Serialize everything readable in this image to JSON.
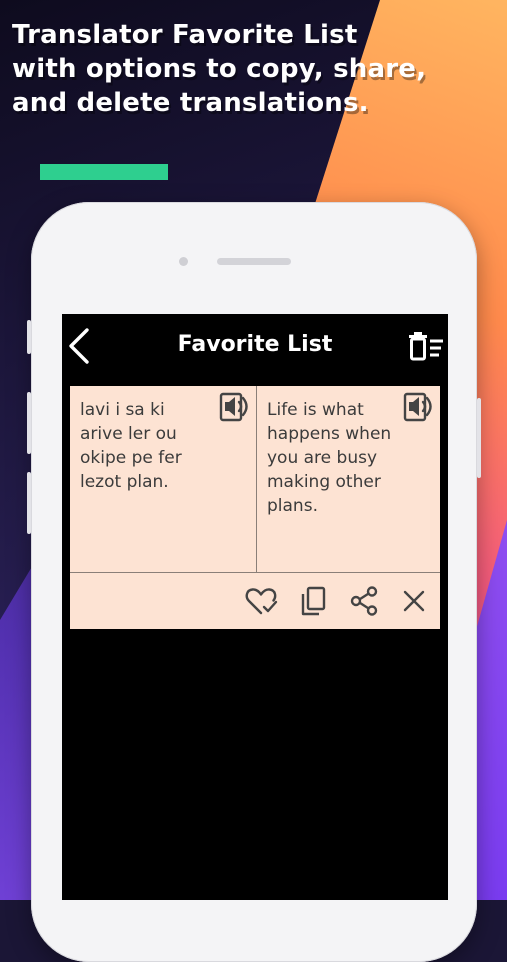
{
  "promo": {
    "headline_lines": [
      "Translator Favorite List",
      "with options to copy, share,",
      "and delete translations."
    ],
    "accent_color": "#2ecf8f"
  },
  "app_bar": {
    "title": "Favorite List",
    "back_icon": "chevron-left-icon",
    "delete_all_icon": "delete-list-icon"
  },
  "favorites": [
    {
      "source_text": "lavi i sa ki arive ler ou okipe pe fer lezot plan.",
      "target_text": "Life is what happens when you are busy making other plans.",
      "card_color": "#fde3d3",
      "actions": [
        "heart-check-icon",
        "copy-icon",
        "share-icon",
        "close-icon"
      ]
    }
  ]
}
